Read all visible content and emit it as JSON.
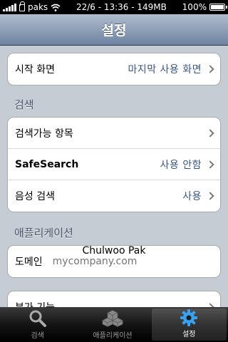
{
  "status_bar": {
    "carrier": "paks",
    "datetime": "22/6 - 13:36 - 149MB",
    "battery": "100%"
  },
  "nav": {
    "title": "설정"
  },
  "groups": {
    "start": {
      "label": "시작 화면",
      "value": "마지막 사용 화면"
    },
    "search_header": "검색",
    "search_items": {
      "searchable": {
        "label": "검색가능 항목"
      },
      "safesearch": {
        "label": "SafeSearch",
        "value": "사용 안함"
      },
      "voice": {
        "label": "음성 검색",
        "value": "사용"
      }
    },
    "apps_header": "애플리케이션",
    "domain": {
      "label": "도메인",
      "placeholder": "mycompany.com"
    },
    "partial": {
      "label": "부가 기능"
    }
  },
  "overlay_name": "Chulwoo Pak",
  "tabs": [
    {
      "label": "검색",
      "icon": "search-icon"
    },
    {
      "label": "애플리케이션",
      "icon": "apps-icon"
    },
    {
      "label": "설정",
      "icon": "gear-icon"
    }
  ],
  "colors": {
    "nav_top": "#b0bccd",
    "nav_bottom": "#6d83a2",
    "value_blue": "#385487",
    "background": "#c5ccd4"
  }
}
